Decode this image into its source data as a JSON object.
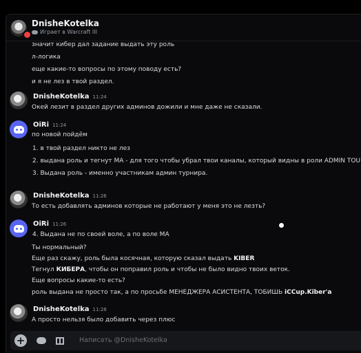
{
  "header": {
    "username": "DnisheKotelka",
    "chevron": "›",
    "activity": "Играет в Warcraft III",
    "status_color": "#f23f43"
  },
  "messages": {
    "intro_lines": [
      "значит кибер дал задание выдать эту роль",
      "л-логика",
      "еще какие-то вопросы по этому поводу есть?",
      "и я не лез в твой раздел."
    ],
    "m1": {
      "author": "DnisheKotelka",
      "time": "11:24",
      "text": "Окей лезит в раздел других админов дожили и мне даже не сказали."
    },
    "m2": {
      "author": "OiRi",
      "time": "11:24",
      "lines": [
        "по новой пойдём",
        "1.  в твой раздел никто не лез",
        "2.  выдана роль и тегнут МА - для того чтобы убрал твои каналы, который видны в роли ADMIN TOUR",
        "3.  Выдана роль - именно участникам админ турнира."
      ]
    },
    "m3": {
      "author": "DnisheKotelka",
      "time": "11:26",
      "text": "То есть добавлять админов которые не работают у меня это не лезть?"
    },
    "m4": {
      "author": "OiRi",
      "time": "11:26",
      "l1": "4.  Выдана не по своей воле, а по воле МА",
      "l2": "Ты нормальный?",
      "l3_pre": "Еще раз скажу, роль была косячная, которую сказал выдать ",
      "l3_bold": "KIBER",
      "l4_pre": "Тегнул ",
      "l4_bold": "КИБЕРА",
      "l4_post": ", чтобы он поправил роль и чтобы не было видно твоих веток.",
      "l5": "Еще вопросы какие-то есть?",
      "l6_pre": "роль выдана не просто так, а по просьбе МЕНЕДЖЕРА АСИСТЕНТА, ТОБИШЬ ",
      "l6_bold": "iCCup.Kiber'a"
    },
    "m5": {
      "author": "DnisheKotelka",
      "time": "11:28",
      "text": "А просто нельзя было добавить через плюс"
    }
  },
  "composer": {
    "placeholder": "Написать @DnisheKotelka",
    "plus": "+"
  },
  "colors": {
    "accent": "#5865f2",
    "background": "#0a0a0c"
  }
}
